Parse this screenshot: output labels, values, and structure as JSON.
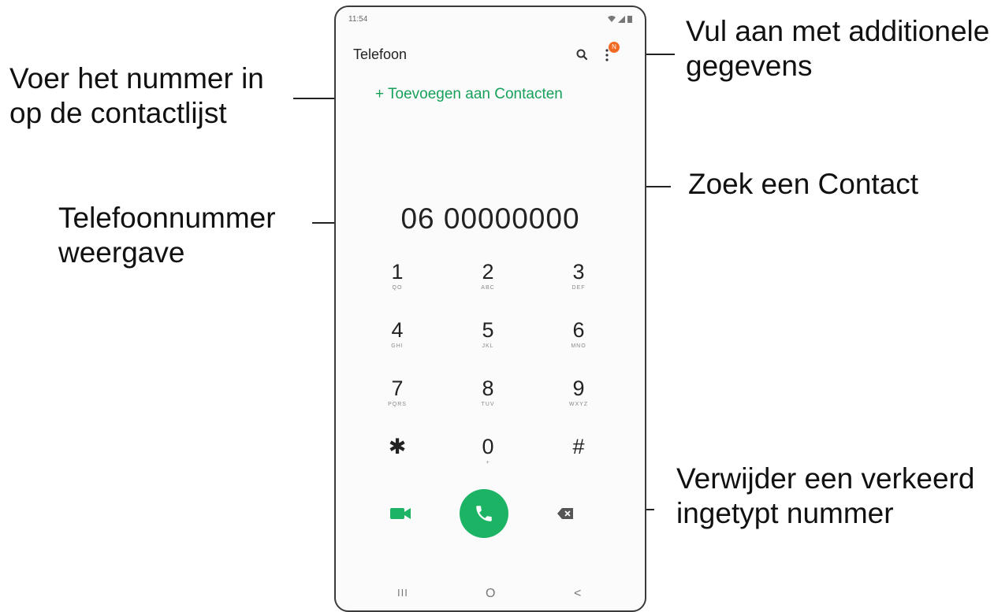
{
  "callouts": {
    "add_contact": "Voer het nummer in\nop de contactlijst",
    "more_options": "Vul aan met additionele\ngegevens",
    "search": "Zoek een Contact",
    "number_display": "Telefoonnummer\nweergave",
    "backspace": "Verwijder een verkeerd\ningetypt nummer"
  },
  "status_bar": {
    "time": "11:54"
  },
  "app": {
    "title": "Telefoon",
    "add_contact_label": "+ Toevoegen aan Contacten",
    "badge": "N"
  },
  "dialer": {
    "number": "06 00000000",
    "keys": [
      {
        "digit": "1",
        "letters": "QO"
      },
      {
        "digit": "2",
        "letters": "ABC"
      },
      {
        "digit": "3",
        "letters": "DEF"
      },
      {
        "digit": "4",
        "letters": "GHI"
      },
      {
        "digit": "5",
        "letters": "JKL"
      },
      {
        "digit": "6",
        "letters": "MNO"
      },
      {
        "digit": "7",
        "letters": "PQRS"
      },
      {
        "digit": "8",
        "letters": "TUV"
      },
      {
        "digit": "9",
        "letters": "WXYZ"
      },
      {
        "digit": "✱",
        "letters": ""
      },
      {
        "digit": "0",
        "letters": "+"
      },
      {
        "digit": "#",
        "letters": ""
      }
    ]
  },
  "navigation": {
    "recents": "III",
    "home": "O",
    "back": "<"
  },
  "colors": {
    "accent": "#17a05a",
    "call_button": "#1db364",
    "badge": "#f06a26"
  },
  "icons": [
    "search-icon",
    "more-options-icon",
    "video-call-icon",
    "phone-icon",
    "backspace-icon"
  ]
}
